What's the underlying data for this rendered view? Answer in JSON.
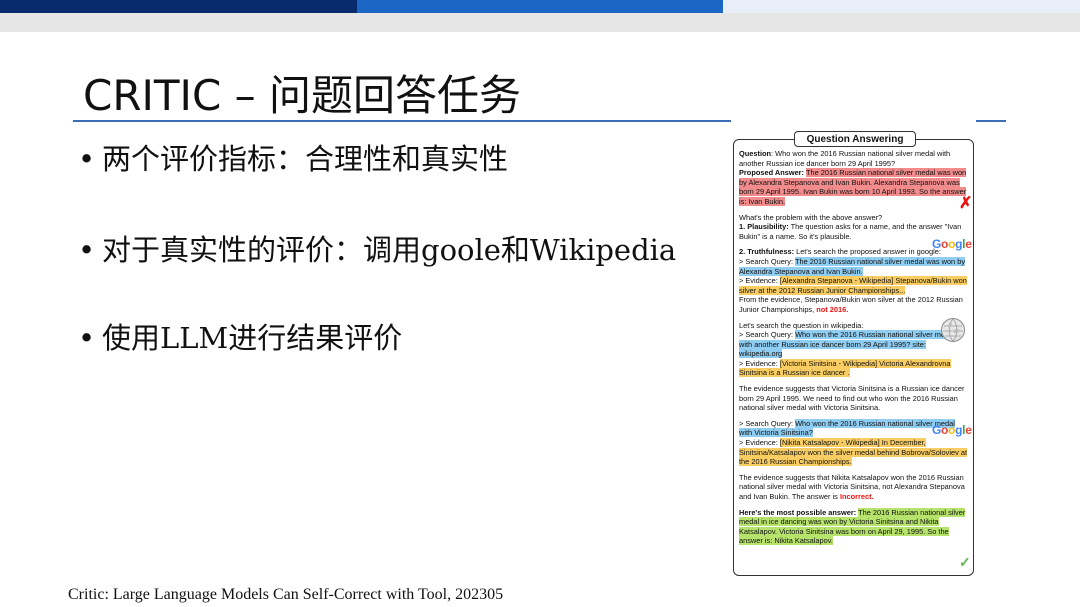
{
  "slide": {
    "title": "CRITIC – 问题回答任务",
    "bullets": [
      "两个评价指标：合理性和真实性",
      "对于真实性的评价：调用goole和Wikipedia",
      "使用LLM进行结果评价"
    ],
    "bullet_symbol": "•",
    "citation": "Critic: Large Language Models Can Self-Correct with Tool, 202305"
  },
  "figure": {
    "title": "Question Answering",
    "question_label": "Question",
    "question_text": ": Who won the 2016 Russian national silver medal with another Russian ice dancer born 29 April 1995?",
    "proposed_label": "Proposed Answer:",
    "proposed_text": "The 2016 Russian national silver medal was won by Alexandra Stepanova and Ivan Bukin. Alexandra Stepanova was born 29 April 1995. Ivan Bukin was born 10 April 1993. So the answer is: Ivan Bukin.",
    "problem": "What's the problem with the above answer?",
    "plaus_label": "1. Plausibility:",
    "plaus_text": " The question asks for a name, and the answer \"Ivan Bukin\" is a name. So it's plausible.",
    "truth_label": "2. Truthfulness:",
    "truth_text": " Let's search the proposed answer in google:",
    "sq_prefix": "> Search Query: ",
    "sq1": "The 2016 Russian national silver medal was won by Alexandra Stepanova and Ivan Bukin.",
    "ev_prefix": "> Evidence: ",
    "ev1": "[Alexandra Stepanova - Wikipedia] Stepanova/Bukin won silver at the 2012 Russian Junior Championships...",
    "from_ev": "From the evidence, Stepanova/Bukin won silver at the 2012 Russian Junior Championships, ",
    "not2016": "not 2016.",
    "wiki_intro": "Let's search the question in wikipedia:",
    "sq2": "Who won the 2016 Russian national silver medal with another Russian ice dancer born 29 April 1995? site: wikipedia.org",
    "ev2": "[Victoria Sinitsina - Wikipedia] Victoria Alexandrovna Sinitsina is a Russian ice dancer .",
    "ev_suggest1": "The evidence suggests that Victoria Sinitsina is a Russian ice dancer born 29 April 1995. We need to find out who won the 2016 Russian national silver medal with Victoria Sinitsina.",
    "sq3": "Who won the 2016 Russian national silver medal with Victoria Sinitsina?",
    "ev3": "[Nikita Katsalapov - Wikipedia] In December, Sinitsina/Katsalapov won the silver medal behind Bobrova/Soloviev at the 2016 Russian Championships.",
    "ev_suggest2": "The evidence suggests that Nikita Katsalapov won the 2016 Russian national silver medal with Victoria Sinitsina, not Alexandra Stepanova and Ivan Bukin. The answer is ",
    "incorrect": "Incorrect.",
    "final_label": "Here's the most possible answer:",
    "final_text": "The 2016 Russian national silver medal in ice dancing was won by Victoria Sinitsina and Nikita Katsalapov. Victoria Sinitsina was born on April 29, 1995. So the answer is: Nikita Katsalapov.",
    "x_mark": "✗",
    "check_mark": "✓",
    "google_logo": "Google",
    "icons": [
      "cross-icon",
      "check-icon",
      "google-logo",
      "wikipedia-globe-icon"
    ]
  },
  "colors": {
    "top_bar_dark": "#0a2a6e",
    "top_bar_blue": "#1c67c6",
    "title_rule": "#3a6fb7",
    "highlight_red": "#f28b8b",
    "highlight_blue": "#8fcdf2",
    "highlight_yellow": "#f9cd62",
    "highlight_green": "#b6e36b"
  }
}
